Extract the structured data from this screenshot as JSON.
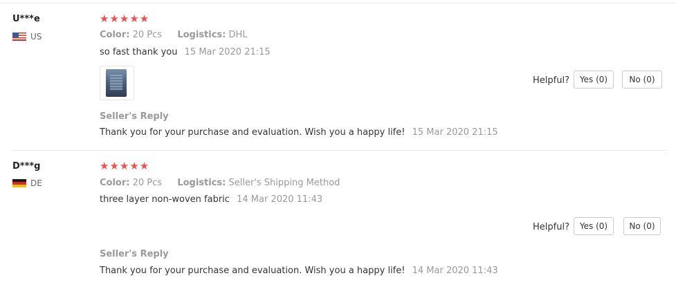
{
  "reviews": [
    {
      "user": "U***e",
      "country": "US",
      "flag_icon": "us-flag-icon",
      "stars": "★★★★★",
      "color_label": "Color:",
      "color_value": "20 Pcs",
      "logistics_label": "Logistics:",
      "logistics_value": "DHL",
      "comment": "so fast thank you",
      "comment_date": "15 Mar 2020 21:15",
      "has_photo": true,
      "helpful_label": "Helpful?",
      "yes_label": "Yes (0)",
      "no_label": "No (0)",
      "reply_title": "Seller's Reply",
      "reply_text": "Thank you for your purchase and evaluation. Wish you a happy life!",
      "reply_date": "15 Mar 2020 21:15"
    },
    {
      "user": "D***g",
      "country": "DE",
      "flag_icon": "de-flag-icon",
      "stars": "★★★★★",
      "color_label": "Color:",
      "color_value": "20 Pcs",
      "logistics_label": "Logistics:",
      "logistics_value": "Seller's Shipping Method",
      "comment": "three layer non-woven fabric",
      "comment_date": "14 Mar 2020 11:43",
      "has_photo": false,
      "helpful_label": "Helpful?",
      "yes_label": "Yes (0)",
      "no_label": "No (0)",
      "reply_title": "Seller's Reply",
      "reply_text": "Thank you for your purchase and evaluation. Wish you a happy life!",
      "reply_date": "14 Mar 2020 11:43"
    }
  ],
  "colors": {
    "star": "#f04f4f",
    "muted": "#999999",
    "text": "#333333",
    "border": "#cccccc"
  }
}
